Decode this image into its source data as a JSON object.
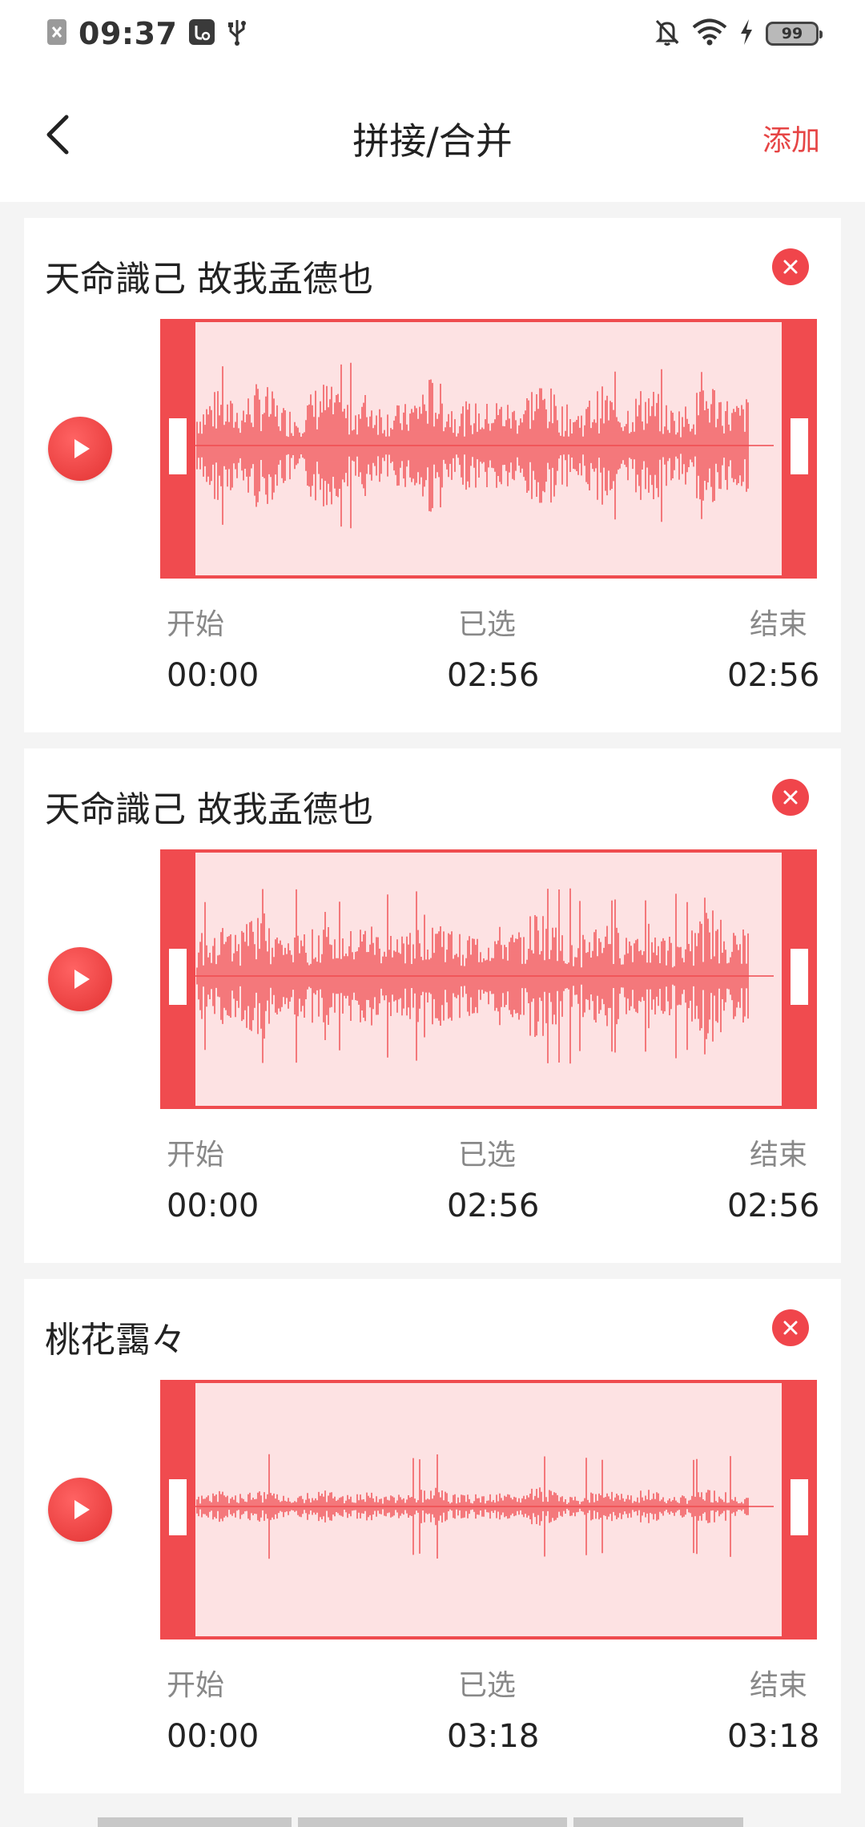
{
  "status_bar": {
    "time": "09:37",
    "battery": "99",
    "icons": [
      "close-box-icon",
      "usb-debug-icon",
      "usb-icon",
      "bell-off-icon",
      "wifi-icon",
      "charging-bolt-icon"
    ]
  },
  "nav": {
    "title": "拼接/合并",
    "add_label": "添加",
    "back_icon": "chevron-left-icon"
  },
  "colors": {
    "accent": "#f04b4f",
    "wave_fill": "#fde2e3",
    "text_secondary": "#888888"
  },
  "labels": {
    "start": "开始",
    "selected": "已选",
    "end": "结束"
  },
  "clips": [
    {
      "title": "天命識己 故我孟德也",
      "start": "00:00",
      "selected": "02:56",
      "end": "02:56"
    },
    {
      "title": "天命識己 故我孟德也",
      "start": "00:00",
      "selected": "02:56",
      "end": "02:56"
    },
    {
      "title": "桃花靄々",
      "start": "00:00",
      "selected": "03:18",
      "end": "03:18"
    }
  ]
}
